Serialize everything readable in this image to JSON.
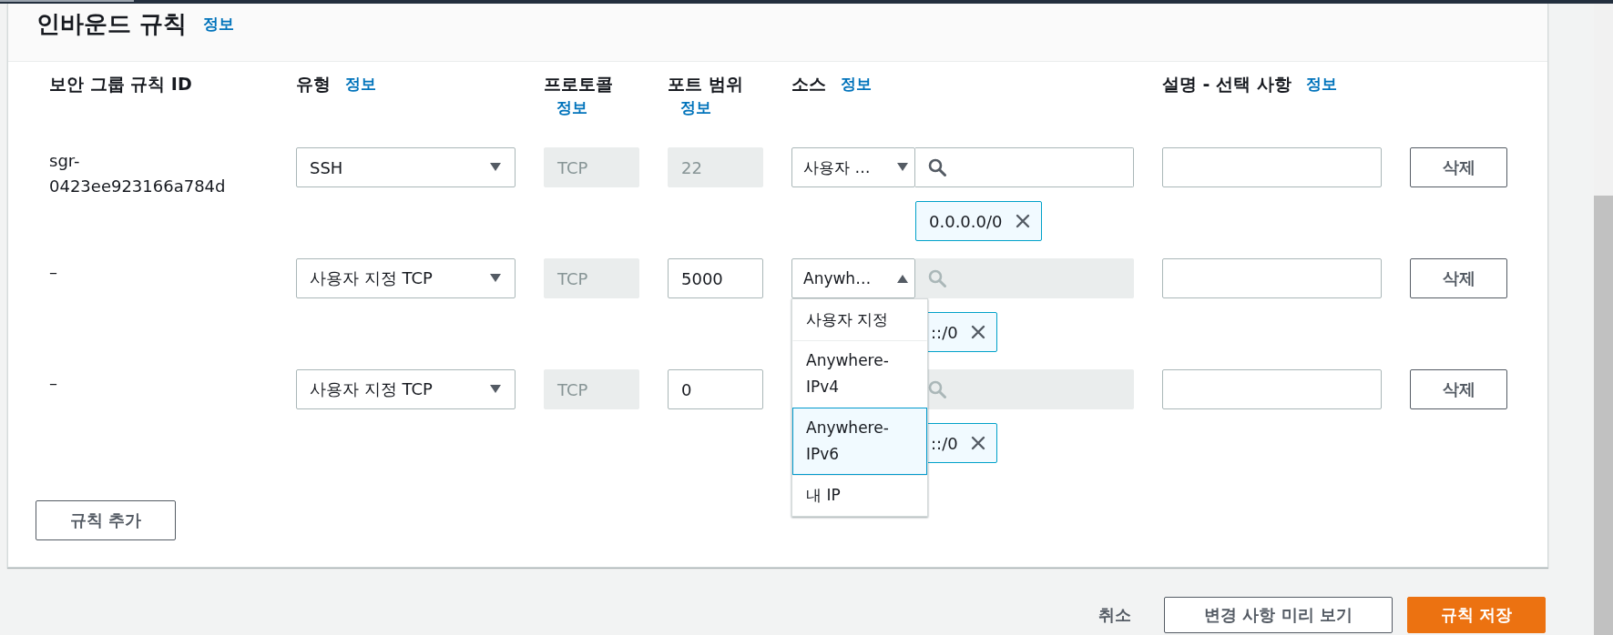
{
  "section": {
    "title": "인바운드 규칙",
    "info_link": "정보"
  },
  "columns": [
    {
      "label": "보안 그룹 규칙 ID"
    },
    {
      "label": "유형",
      "info_link": "정보"
    },
    {
      "label": "프로토콜",
      "info_link": "정보"
    },
    {
      "label": "포트 범위",
      "info_link": "정보"
    },
    {
      "label": "소스",
      "info_link": "정보"
    },
    {
      "label": "설명 - 선택 사항",
      "info_link": "정보"
    }
  ],
  "rows": [
    {
      "id": "sgr-0423ee923166a784d",
      "type": "SSH",
      "protocol": "TCP",
      "port": "22",
      "port_disabled": true,
      "source": {
        "value": "사용자 …",
        "expanded": false
      },
      "search_disabled": false,
      "tokens": [
        {
          "label": "0.0.0.0/0"
        }
      ],
      "delete": "삭제"
    },
    {
      "id": "–",
      "type": "사용자 지정 TCP",
      "protocol": "TCP",
      "port": "5000",
      "port_disabled": false,
      "source": {
        "value": "Anywh…",
        "expanded": true,
        "options": [
          {
            "label": "사용자 지정",
            "selected": false
          },
          {
            "label": "Anywhere-IPv4",
            "selected": false
          },
          {
            "label": "Anywhere-IPv6",
            "selected": true
          },
          {
            "label": "내 IP",
            "selected": false
          }
        ]
      },
      "search_disabled": true,
      "tokens": [
        {
          "label": "::/0"
        }
      ],
      "delete": "삭제"
    },
    {
      "id": "–",
      "type": "사용자 지정 TCP",
      "protocol": "TCP",
      "port": "0",
      "port_disabled": false,
      "search_disabled": true,
      "tokens": [
        {
          "label": "::/0"
        }
      ],
      "delete": "삭제"
    }
  ],
  "add_button": "규칙 추가",
  "footer": {
    "cancel": "취소",
    "preview": "변경 사항 미리 보기",
    "save": "규칙 저장"
  }
}
